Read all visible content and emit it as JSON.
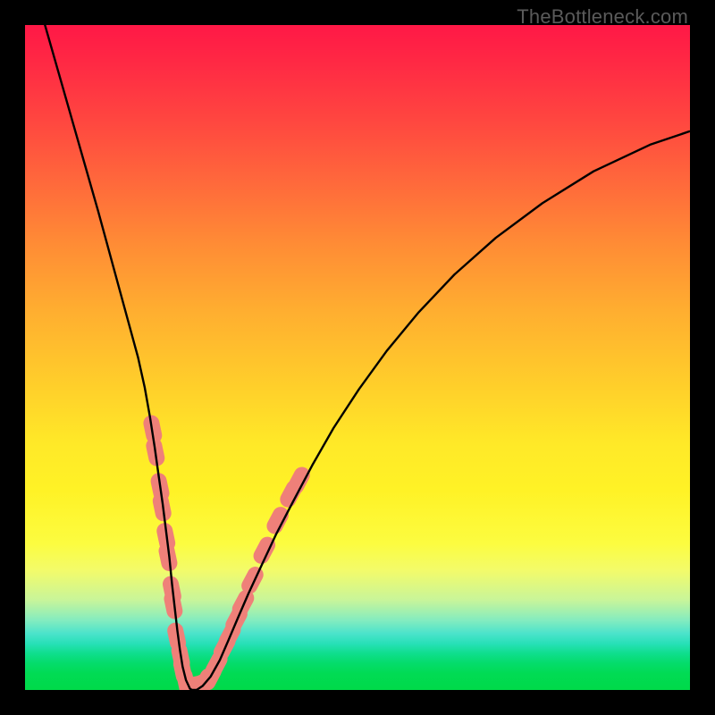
{
  "watermark": "TheBottleneck.com",
  "colors": {
    "gradient_top": "#ff1846",
    "gradient_mid": "#ffe928",
    "gradient_bottom": "#00da49",
    "curve": "#000000",
    "dots": "#ef8079",
    "frame": "#000000"
  },
  "chart_data": {
    "type": "line",
    "title": "",
    "xlabel": "",
    "ylabel": "",
    "xlim": [
      0,
      100
    ],
    "ylim": [
      0,
      100
    ],
    "x": [
      3,
      5,
      7,
      9,
      11,
      12.5,
      14,
      15.5,
      17,
      18,
      18.8,
      19.5,
      20.1,
      20.7,
      21.2,
      21.7,
      22.1,
      22.5,
      22.9,
      23.3,
      23.7,
      24.2,
      24.8,
      25.1,
      25.8,
      26.7,
      27.9,
      29.3,
      30.6,
      32,
      33.6,
      35.6,
      37.8,
      40.4,
      43.2,
      46.4,
      50.2,
      54.4,
      59.2,
      64.6,
      70.8,
      77.8,
      85.5,
      94.0,
      99.9
    ],
    "values": [
      100.0,
      93.0,
      86.0,
      79.0,
      72.0,
      66.5,
      61.0,
      55.5,
      50.0,
      45.5,
      41.0,
      36.5,
      32.2,
      28.0,
      24.0,
      20.0,
      16.0,
      12.5,
      9.0,
      6.0,
      3.5,
      1.5,
      0.2,
      0.0,
      0.0,
      0.6,
      2.0,
      4.5,
      7.5,
      10.8,
      14.5,
      18.8,
      23.5,
      28.5,
      33.8,
      39.4,
      45.2,
      51.0,
      56.8,
      62.5,
      68.0,
      73.2,
      78.0,
      82.0,
      84.0
    ],
    "series_name": "bottleneck-curve",
    "left_cluster": {
      "description": "salmon sample dots along left (descending) branch",
      "points": [
        {
          "x": 19.2,
          "y": 39.2
        },
        {
          "x": 19.6,
          "y": 35.8
        },
        {
          "x": 20.3,
          "y": 30.5
        },
        {
          "x": 20.6,
          "y": 27.5
        },
        {
          "x": 21.2,
          "y": 23.0
        },
        {
          "x": 21.5,
          "y": 20.0
        },
        {
          "x": 22.1,
          "y": 15.0
        },
        {
          "x": 22.3,
          "y": 12.8
        },
        {
          "x": 22.8,
          "y": 8.0
        },
        {
          "x": 23.4,
          "y": 5.0
        },
        {
          "x": 23.7,
          "y": 3.0
        },
        {
          "x": 24.2,
          "y": 1.2
        }
      ]
    },
    "right_cluster": {
      "description": "salmon sample dots along right (ascending) branch",
      "points": [
        {
          "x": 25.1,
          "y": 0.0
        },
        {
          "x": 25.6,
          "y": 0.1
        },
        {
          "x": 26.2,
          "y": 0.3
        },
        {
          "x": 27.1,
          "y": 1.2
        },
        {
          "x": 27.9,
          "y": 2.0
        },
        {
          "x": 28.8,
          "y": 3.8
        },
        {
          "x": 30.0,
          "y": 6.5
        },
        {
          "x": 30.8,
          "y": 8.2
        },
        {
          "x": 31.8,
          "y": 10.6
        },
        {
          "x": 32.8,
          "y": 13.0
        },
        {
          "x": 34.2,
          "y": 16.5
        },
        {
          "x": 36.0,
          "y": 21.0
        },
        {
          "x": 38.0,
          "y": 25.5
        },
        {
          "x": 40.0,
          "y": 29.5
        },
        {
          "x": 41.2,
          "y": 31.5
        }
      ]
    }
  }
}
